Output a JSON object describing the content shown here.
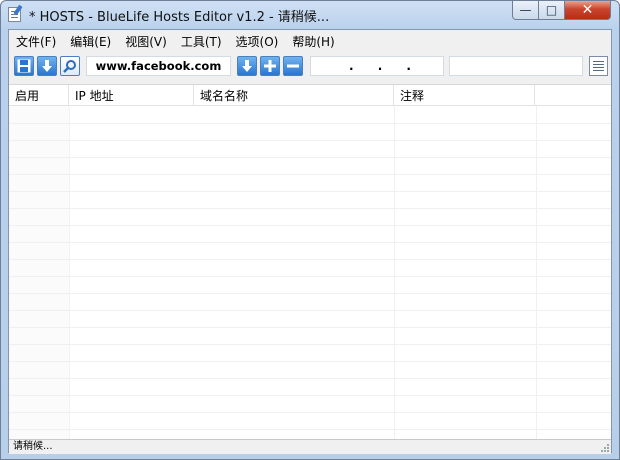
{
  "window": {
    "title": "* HOSTS - BlueLife Hosts Editor v1.2 - 请稍候..."
  },
  "caption_buttons": {
    "minimize": "—",
    "maximize": "□",
    "close": "✕"
  },
  "menu": [
    {
      "label": "文件(F)"
    },
    {
      "label": "编辑(E)"
    },
    {
      "label": "视图(V)"
    },
    {
      "label": "工具(T)"
    },
    {
      "label": "选项(O)"
    },
    {
      "label": "帮助(H)"
    }
  ],
  "toolbar": {
    "icons": [
      "save-icon",
      "download-icon",
      "search-icon",
      "import-icon",
      "add-icon",
      "remove-icon",
      "list-icon"
    ],
    "domain_value": "www.facebook.com",
    "ip_dots": [
      ".",
      ".",
      "."
    ],
    "note_value": ""
  },
  "table": {
    "columns": [
      "启用",
      "IP 地址",
      "域名名称",
      "注释",
      ""
    ],
    "rows": []
  },
  "status": {
    "text": "请稍候..."
  },
  "colors": {
    "title_bar": "#b9d1ec",
    "accent": "#2a76cf",
    "close_button": "#c9452d"
  }
}
